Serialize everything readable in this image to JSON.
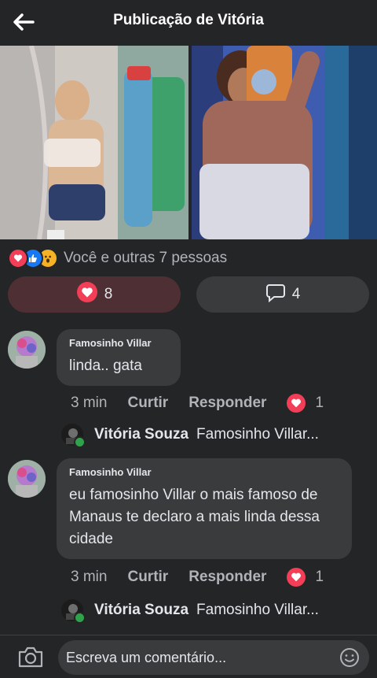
{
  "header": {
    "title": "Publicação de Vitória"
  },
  "post": {
    "reactions_text": "Você e outras 7 pessoas",
    "reaction_icons": [
      "love-icon",
      "like-icon",
      "wow-icon"
    ],
    "love_count": "8",
    "comment_count": "4"
  },
  "comments": [
    {
      "author": "Famosinho Villar",
      "text": "linda.. gata",
      "time": "3 min",
      "like_label": "Curtir",
      "reply_label": "Responder",
      "reaction_count": "1",
      "reply": {
        "author": "Vitória Souza",
        "snippet": "Famosinho Villar..."
      }
    },
    {
      "author": "Famosinho Villar",
      "text": "eu famosinho Villar o mais famoso de Manaus te declaro a mais linda dessa cidade",
      "time": "3 min",
      "like_label": "Curtir",
      "reply_label": "Responder",
      "reaction_count": "1",
      "reply": {
        "author": "Vitória Souza",
        "snippet": "Famosinho Villar..."
      }
    }
  ],
  "composer": {
    "placeholder": "Escreva um comentário..."
  },
  "colors": {
    "background": "#242526",
    "bubble": "#3a3b3c",
    "love": "#f33e58",
    "online": "#31a24c"
  }
}
